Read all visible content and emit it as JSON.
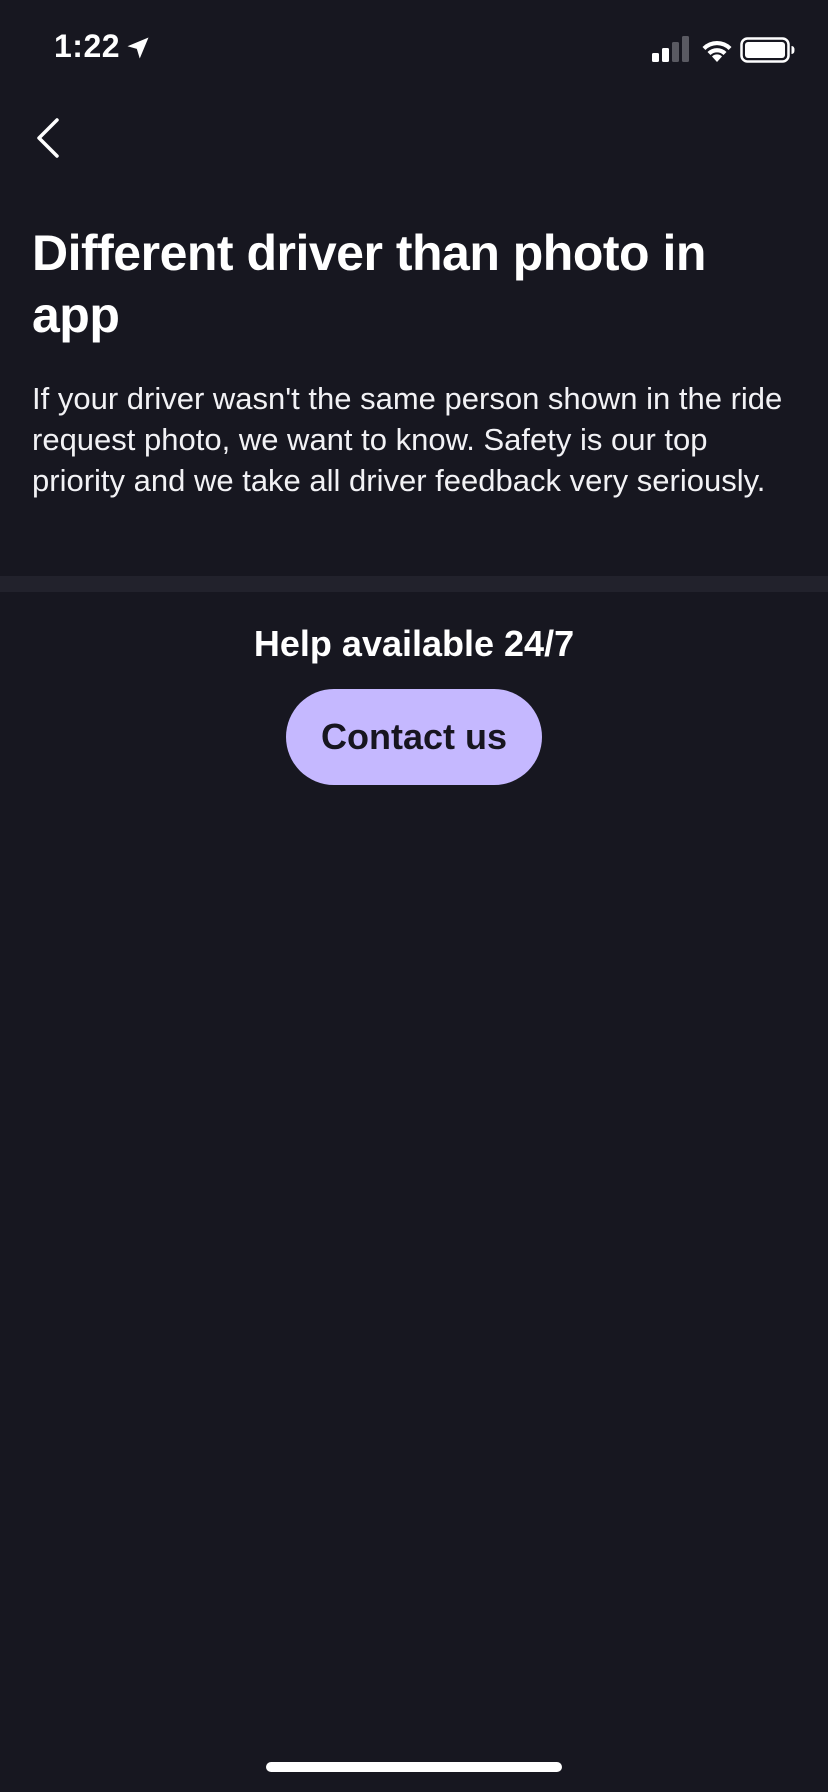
{
  "status_bar": {
    "time": "1:22",
    "icons": [
      "location-arrow-icon",
      "cellular-signal-icon",
      "wifi-icon",
      "battery-icon"
    ]
  },
  "navigation": {
    "back_icon": "chevron-left-icon"
  },
  "main": {
    "title": "Different driver than photo in app",
    "description": "If your driver wasn't the same person shown in the ride request photo, we want to know. Safety is our top priority and we take all driver feedback very seriously."
  },
  "help": {
    "heading": "Help available 24/7",
    "contact_label": "Contact us"
  },
  "colors": {
    "background": "#171720",
    "divider": "#22222c",
    "accent_button": "#c5b8ff",
    "button_text": "#17151f",
    "text": "#ffffff"
  }
}
